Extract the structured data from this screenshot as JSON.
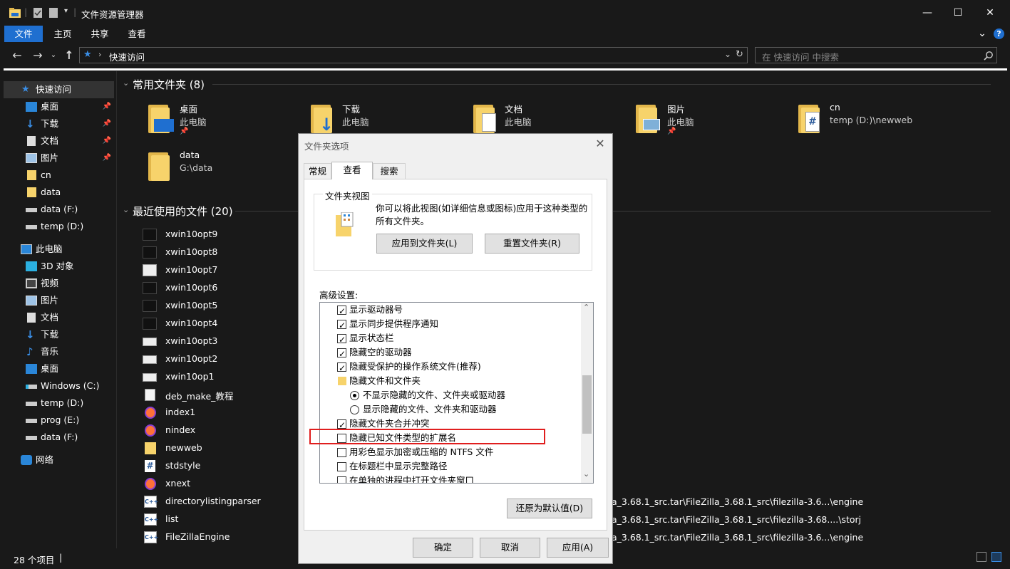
{
  "window": {
    "title": "文件资源管理器",
    "controls": {
      "minimize": "—",
      "maximize": "☐",
      "close": "✕"
    }
  },
  "ribbon": {
    "tabs": [
      "文件",
      "主页",
      "共享",
      "查看"
    ],
    "expand": "⌄",
    "help": "?"
  },
  "address": {
    "path": "快速访问",
    "search_placeholder": "在 快速访问 中搜索"
  },
  "sidebar": {
    "items": [
      {
        "label": "快速访问",
        "pinned": false
      },
      {
        "label": "桌面",
        "pinned": true
      },
      {
        "label": "下载",
        "pinned": true
      },
      {
        "label": "文档",
        "pinned": true
      },
      {
        "label": "图片",
        "pinned": true
      },
      {
        "label": "cn",
        "pinned": false
      },
      {
        "label": "data",
        "pinned": false
      },
      {
        "label": "data (F:)",
        "pinned": false
      },
      {
        "label": "temp (D:)",
        "pinned": false
      },
      {
        "label": "此电脑",
        "pinned": false
      },
      {
        "label": "3D 对象",
        "pinned": false
      },
      {
        "label": "视频",
        "pinned": false
      },
      {
        "label": "图片",
        "pinned": false
      },
      {
        "label": "文档",
        "pinned": false
      },
      {
        "label": "下载",
        "pinned": false
      },
      {
        "label": "音乐",
        "pinned": false
      },
      {
        "label": "桌面",
        "pinned": false
      },
      {
        "label": "Windows (C:)",
        "pinned": false
      },
      {
        "label": "temp (D:)",
        "pinned": false
      },
      {
        "label": "prog (E:)",
        "pinned": false
      },
      {
        "label": "data (F:)",
        "pinned": false
      },
      {
        "label": "网络",
        "pinned": false
      }
    ]
  },
  "frequent": {
    "header": "常用文件夹 (8)",
    "folders": [
      {
        "name": "桌面",
        "sub": "此电脑"
      },
      {
        "name": "下载",
        "sub": "此电脑"
      },
      {
        "name": "文档",
        "sub": "此电脑"
      },
      {
        "name": "图片",
        "sub": "此电脑"
      },
      {
        "name": "cn",
        "sub": "temp (D:)\\newweb"
      },
      {
        "name": "data",
        "sub": "G:\\data"
      }
    ]
  },
  "recent": {
    "header": "最近使用的文件 (20)",
    "files": [
      {
        "name": "xwin10opt9",
        "path": ""
      },
      {
        "name": "xwin10opt8",
        "path": ""
      },
      {
        "name": "xwin10opt7",
        "path": ""
      },
      {
        "name": "xwin10opt6",
        "path": ""
      },
      {
        "name": "xwin10opt5",
        "path": ""
      },
      {
        "name": "xwin10opt4",
        "path": ""
      },
      {
        "name": "xwin10opt3",
        "path": ""
      },
      {
        "name": "xwin10opt2",
        "path": ""
      },
      {
        "name": "xwin10op1",
        "path": ""
      },
      {
        "name": "deb_make_教程",
        "path": ""
      },
      {
        "name": "index1",
        "path": ""
      },
      {
        "name": "nindex",
        "path": ""
      },
      {
        "name": "newweb",
        "path": ""
      },
      {
        "name": "stdstyle",
        "path": ""
      },
      {
        "name": "xnext",
        "path": ""
      },
      {
        "name": "directorylistingparser",
        "path": "a_3.68.1_src.tar\\FileZilla_3.68.1_src\\filezilla-3.6...\\engine"
      },
      {
        "name": "list",
        "path": "a_3.68.1_src.tar\\FileZilla_3.68.1_src\\filezilla-3.68....\\storj"
      },
      {
        "name": "FileZillaEngine",
        "path": "a_3.68.1_src.tar\\FileZilla_3.68.1_src\\filezilla-3.6...\\engine"
      }
    ]
  },
  "status": {
    "count": "28 个项目",
    "sep": "|"
  },
  "dialog": {
    "title": "文件夹选项",
    "close": "✕",
    "tabs": [
      "常规",
      "查看",
      "搜索"
    ],
    "folder_view": {
      "legend": "文件夹视图",
      "desc": "你可以将此视图(如详细信息或图标)应用于这种类型的所有文件夹。",
      "apply_btn": "应用到文件夹(L)",
      "reset_btn": "重置文件夹(R)"
    },
    "advanced_label": "高级设置:",
    "options": [
      {
        "kind": "check",
        "checked": true,
        "label": "显示驱动器号"
      },
      {
        "kind": "check",
        "checked": true,
        "label": "显示同步提供程序通知"
      },
      {
        "kind": "check",
        "checked": true,
        "label": "显示状态栏"
      },
      {
        "kind": "check",
        "checked": true,
        "label": "隐藏空的驱动器"
      },
      {
        "kind": "check",
        "checked": true,
        "label": "隐藏受保护的操作系统文件(推荐)"
      },
      {
        "kind": "folder",
        "checked": false,
        "label": "隐藏文件和文件夹"
      },
      {
        "kind": "radio",
        "checked": true,
        "label": "不显示隐藏的文件、文件夹或驱动器"
      },
      {
        "kind": "radio",
        "checked": false,
        "label": "显示隐藏的文件、文件夹和驱动器"
      },
      {
        "kind": "check",
        "checked": true,
        "label": "隐藏文件夹合并冲突"
      },
      {
        "kind": "check",
        "checked": false,
        "label": "隐藏已知文件类型的扩展名"
      },
      {
        "kind": "check",
        "checked": false,
        "label": "用彩色显示加密或压缩的 NTFS 文件"
      },
      {
        "kind": "check",
        "checked": false,
        "label": "在标题栏中显示完整路径"
      },
      {
        "kind": "check",
        "checked": false,
        "label": "在单独的进程中打开文件夹窗口"
      }
    ],
    "restore_btn": "还原为默认值(D)",
    "ok_btn": "确定",
    "cancel_btn": "取消",
    "apply_btn": "应用(A)"
  },
  "colors": {
    "accent": "#1f6fd0",
    "highlight": "#e01e1e",
    "folder": "#f7d36b"
  }
}
